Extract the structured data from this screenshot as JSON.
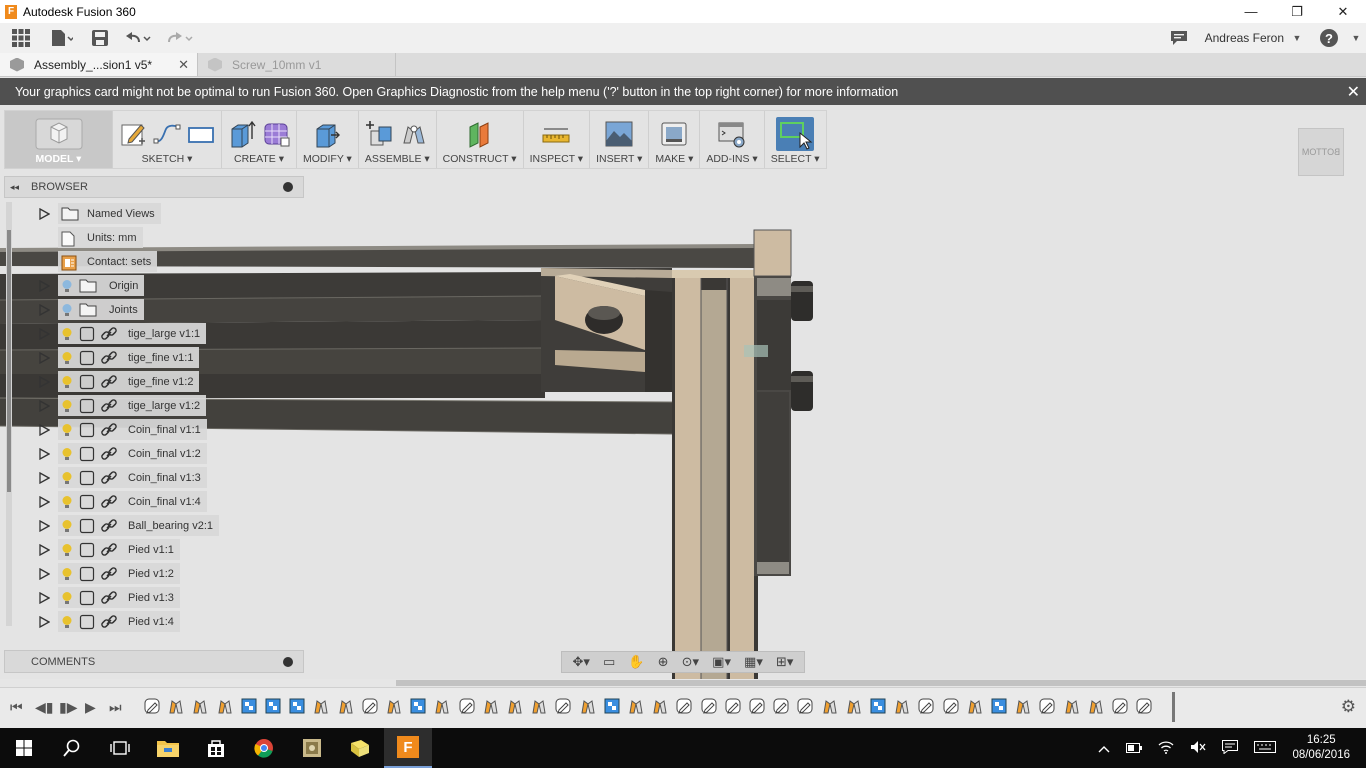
{
  "window": {
    "title": "Autodesk Fusion 360",
    "app_icon_letter": "F",
    "controls": {
      "minimize": "—",
      "maximize": "❐",
      "close": "✕"
    }
  },
  "quick_access": {
    "user_name": "Andreas Feron",
    "help_label": "?"
  },
  "tabs": [
    {
      "label": "Assembly_...sion1 v5*",
      "close": "✕"
    },
    {
      "label": "Screw_10mm v1"
    }
  ],
  "notification": {
    "text": "Your graphics card might not be optimal to run Fusion 360. Open Graphics Diagnostic from the help menu ('?' button in the top right corner) for more information",
    "close": "✕"
  },
  "toolbar": {
    "groups": [
      {
        "label": "MODEL ▾"
      },
      {
        "label": "SKETCH ▾"
      },
      {
        "label": "CREATE ▾"
      },
      {
        "label": "MODIFY ▾"
      },
      {
        "label": "ASSEMBLE ▾"
      },
      {
        "label": "CONSTRUCT ▾"
      },
      {
        "label": "INSPECT ▾"
      },
      {
        "label": "INSERT ▾"
      },
      {
        "label": "MAKE ▾"
      },
      {
        "label": "ADD-INS ▾"
      },
      {
        "label": "SELECT ▾"
      }
    ]
  },
  "viewcube": {
    "label": "BOTTOM"
  },
  "browser": {
    "title": "BROWSER",
    "collapse": "◂◂",
    "items": [
      {
        "label": "Named Views",
        "icon": "folder-icon",
        "expandable": true
      },
      {
        "label": "Units: mm",
        "icon": "document-icon",
        "expandable": false
      },
      {
        "label": "Contact: sets",
        "icon": "contact-sets-icon",
        "expandable": false
      },
      {
        "label": "Origin",
        "icon": "folder-icon",
        "expandable": true,
        "visibility": "off"
      },
      {
        "label": "Joints",
        "icon": "folder-icon",
        "expandable": true,
        "visibility": "off"
      },
      {
        "label": "tige_large v1:1",
        "icon": "component-icon",
        "expandable": true,
        "visibility": "on"
      },
      {
        "label": "tige_fine v1:1",
        "icon": "component-icon",
        "expandable": true,
        "visibility": "on"
      },
      {
        "label": "tige_fine v1:2",
        "icon": "component-icon",
        "expandable": true,
        "visibility": "on"
      },
      {
        "label": "tige_large v1:2",
        "icon": "component-icon",
        "expandable": true,
        "visibility": "on"
      },
      {
        "label": "Coin_final v1:1",
        "icon": "component-icon",
        "expandable": true,
        "visibility": "on"
      },
      {
        "label": "Coin_final v1:2",
        "icon": "component-icon",
        "expandable": true,
        "visibility": "on"
      },
      {
        "label": "Coin_final v1:3",
        "icon": "component-icon",
        "expandable": true,
        "visibility": "on"
      },
      {
        "label": "Coin_final v1:4",
        "icon": "component-icon",
        "expandable": true,
        "visibility": "on"
      },
      {
        "label": "Ball_bearing v2:1",
        "icon": "component-icon",
        "expandable": true,
        "visibility": "on"
      },
      {
        "label": "Pied v1:1",
        "icon": "component-icon",
        "expandable": true,
        "visibility": "on"
      },
      {
        "label": "Pied v1:2",
        "icon": "component-icon",
        "expandable": true,
        "visibility": "on"
      },
      {
        "label": "Pied v1:3",
        "icon": "component-icon",
        "expandable": true,
        "visibility": "on"
      },
      {
        "label": "Pied v1:4",
        "icon": "component-icon",
        "expandable": true,
        "visibility": "on"
      }
    ]
  },
  "comments": {
    "title": "COMMENTS"
  },
  "taskbar": {
    "time": "16:25",
    "date": "08/06/2016"
  },
  "colors": {
    "accent_select": "#4a7fb5",
    "bulb_on": "#e8c22e",
    "bulb_off": "#8cb8de",
    "model_dark": "#3c3a36",
    "model_light": "#cdbba2"
  }
}
